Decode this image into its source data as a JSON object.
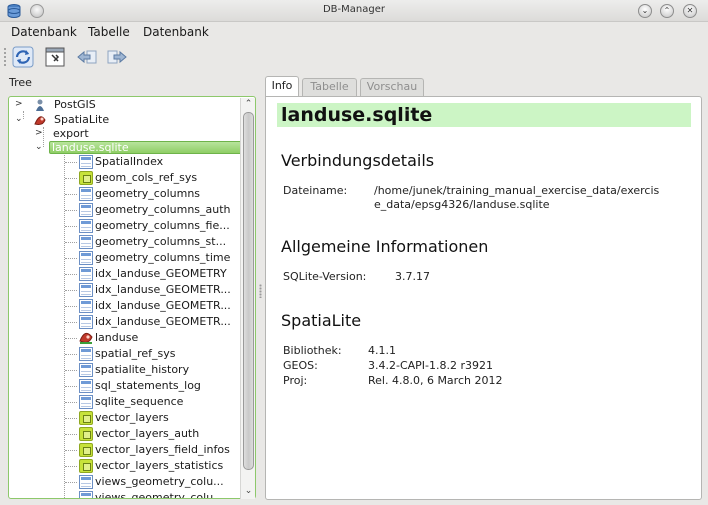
{
  "window": {
    "title": "DB-Manager"
  },
  "menu": {
    "items": [
      "Datenbank",
      "Tabelle",
      "Datenbank"
    ]
  },
  "tree": {
    "label": "Tree",
    "providers": [
      "PostGIS",
      "SpatiaLite"
    ],
    "spatialite_children": [
      "export",
      "landuse.sqlite"
    ],
    "selected": "landuse.sqlite",
    "tables": [
      {
        "name": "SpatialIndex",
        "icon": "table"
      },
      {
        "name": "geom_cols_ref_sys",
        "icon": "view"
      },
      {
        "name": "geometry_columns",
        "icon": "table"
      },
      {
        "name": "geometry_columns_auth",
        "icon": "table"
      },
      {
        "name": "geometry_columns_fie...",
        "icon": "table"
      },
      {
        "name": "geometry_columns_st...",
        "icon": "table"
      },
      {
        "name": "geometry_columns_time",
        "icon": "table"
      },
      {
        "name": "idx_landuse_GEOMETRY",
        "icon": "table"
      },
      {
        "name": "idx_landuse_GEOMETR...",
        "icon": "table"
      },
      {
        "name": "idx_landuse_GEOMETR...",
        "icon": "table"
      },
      {
        "name": "idx_landuse_GEOMETR...",
        "icon": "table"
      },
      {
        "name": "landuse",
        "icon": "layer"
      },
      {
        "name": "spatial_ref_sys",
        "icon": "table"
      },
      {
        "name": "spatialite_history",
        "icon": "table"
      },
      {
        "name": "sql_statements_log",
        "icon": "table"
      },
      {
        "name": "sqlite_sequence",
        "icon": "table"
      },
      {
        "name": "vector_layers",
        "icon": "view"
      },
      {
        "name": "vector_layers_auth",
        "icon": "view"
      },
      {
        "name": "vector_layers_field_infos",
        "icon": "view"
      },
      {
        "name": "vector_layers_statistics",
        "icon": "view"
      },
      {
        "name": "views_geometry_colu...",
        "icon": "table"
      },
      {
        "name": "views_geometry_colu...",
        "icon": "table"
      }
    ]
  },
  "tabs": {
    "info": "Info",
    "table": "Tabelle",
    "preview": "Vorschau"
  },
  "info": {
    "title": "landuse.sqlite",
    "connection": {
      "heading": "Verbindungsdetails",
      "filename_label": "Dateiname:",
      "filename_line1": "/home/junek/training_manual_exercise_data/exercis",
      "filename_line2": "e_data/epsg4326/landuse.sqlite"
    },
    "general": {
      "heading": "Allgemeine Informationen",
      "version_label": "SQLite-Version:",
      "version_value": "3.7.17"
    },
    "spatialite": {
      "heading": "SpatiaLite",
      "rows": [
        {
          "label": "Bibliothek:",
          "value": "4.1.1"
        },
        {
          "label": "GEOS:",
          "value": "3.4.2-CAPI-1.8.2 r3921"
        },
        {
          "label": "Proj:",
          "value": "Rel. 4.8.0, 6 March 2012"
        }
      ]
    }
  }
}
